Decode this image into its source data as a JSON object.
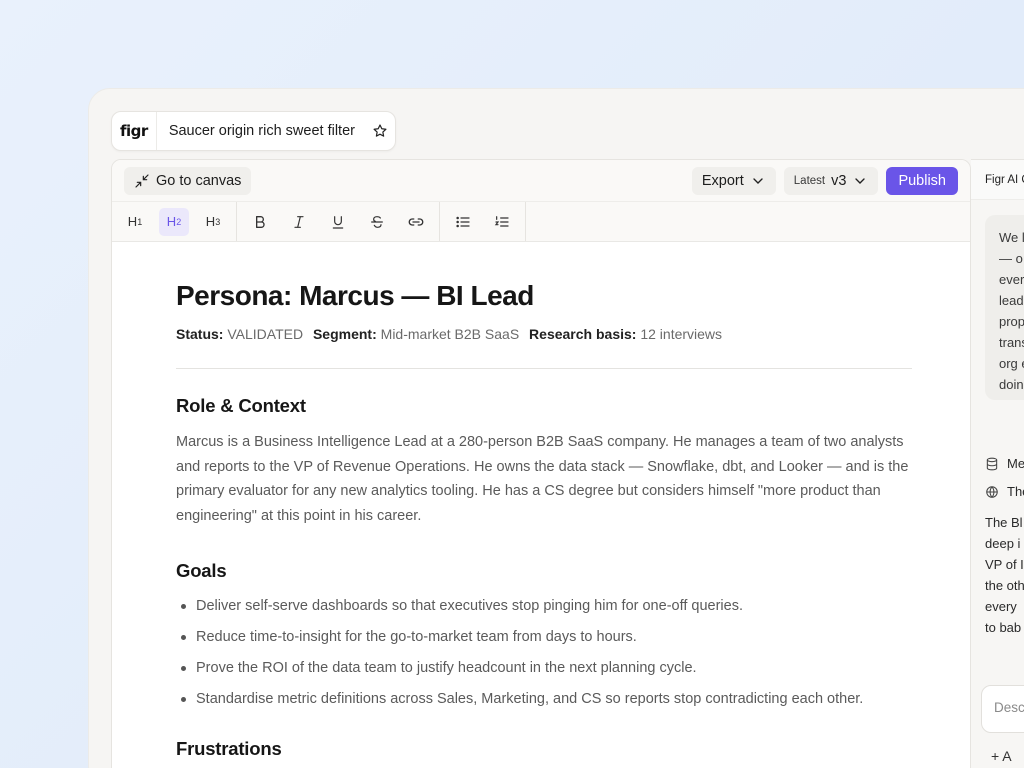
{
  "app": {
    "logo": "figr",
    "doc_title": "Saucer origin rich sweet filter"
  },
  "topbar": {
    "go_to_canvas": "Go to canvas",
    "export": "Export",
    "version_tag": "Latest",
    "version": "v3",
    "publish": "Publish"
  },
  "format": {
    "h1": "H",
    "h1_sub": "1",
    "h2": "H",
    "h2_sub": "2",
    "h3": "H",
    "h3_sub": "3"
  },
  "doc": {
    "title": "Persona: Marcus — BI Lead",
    "meta": {
      "status_label": "Status:",
      "status_value": "VALIDATED",
      "segment_label": "Segment:",
      "segment_value": "Mid-market B2B SaaS",
      "basis_label": "Research basis:",
      "basis_value": "12 interviews"
    },
    "role_heading": "Role & Context",
    "role_text": "Marcus is a Business Intelligence Lead at a 280-person B2B SaaS company. He manages a team of two analysts and reports to the VP of Revenue Operations. He owns the data stack — Snowflake, dbt, and Looker — and is the primary evaluator for any new analytics tooling. He has a CS degree but considers himself \"more product than engineering\" at this point in his career.",
    "goals_heading": "Goals",
    "goals": [
      "Deliver self-serve dashboards so that executives stop pinging him for one-off queries.",
      "Reduce time-to-insight for the go-to-market team from days to hours.",
      "Prove the ROI of the data team to justify headcount in the next planning cycle.",
      "Standardise metric definitions across Sales, Marketing, and CS so reports stop contradicting each other."
    ],
    "frustrations_heading": "Frustrations"
  },
  "ai_panel": {
    "header": "Figr AI C",
    "bubble_lines": [
      "We l",
      "— o",
      "ever",
      "lead",
      "prop",
      "trans",
      "org e",
      "doin"
    ],
    "row1": "Me",
    "row2": "The",
    "text_lines": [
      "The Bl",
      "deep i",
      "VP of I",
      "the oth",
      "every",
      "to bab"
    ],
    "input_placeholder": "Desc",
    "add_label": "+ A"
  },
  "colors": {
    "accent": "#6a55e8",
    "background": "#e6effb"
  }
}
